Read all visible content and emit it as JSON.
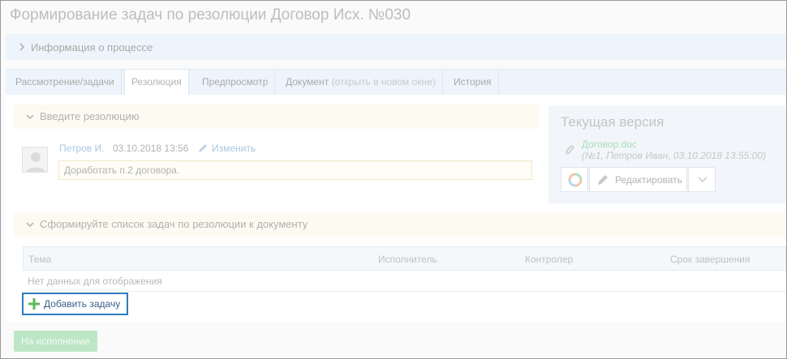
{
  "page": {
    "title": "Формирование задач по резолюции Договор Исх. №030"
  },
  "process_section": {
    "label": "Информация о процессе",
    "icon": "chevron-right-icon"
  },
  "tabs": [
    {
      "label": "Рассмотрение/задачи",
      "active": false
    },
    {
      "label": "Резолюция",
      "active": true
    },
    {
      "label": "Предпросмотр",
      "active": false
    },
    {
      "label": "Документ",
      "extra": "(открыть в новом окне)",
      "active": false
    },
    {
      "label": "История",
      "active": false
    }
  ],
  "resolution_section": {
    "header": "Введите резолюцию",
    "author": "Петров И.",
    "datetime": "03.10.2018 13:56",
    "edit_label": "Изменить",
    "text": "Доработать п.2 договора."
  },
  "current_version": {
    "title": "Текущая версия",
    "file_name": "Договор.doc",
    "file_meta": "(№1, Петров Иван, 03.10.2018 13:55:00)",
    "edit_button": "Редактировать"
  },
  "tasks_section": {
    "header": "Сформируйте список задач по резолюции к документу",
    "columns": [
      "Тема",
      "Исполнитель",
      "Контролер",
      "Срок завершения"
    ],
    "empty_text": "Нет данных для отображения",
    "add_button": "Добавить задачу"
  },
  "footer": {
    "submit_button": "На исполнение"
  },
  "colors": {
    "accent_blue": "#2e7bc4",
    "link": "#a9c6e2",
    "submit_bg": "#bde6c6",
    "add_icon": "#5cb85c"
  }
}
